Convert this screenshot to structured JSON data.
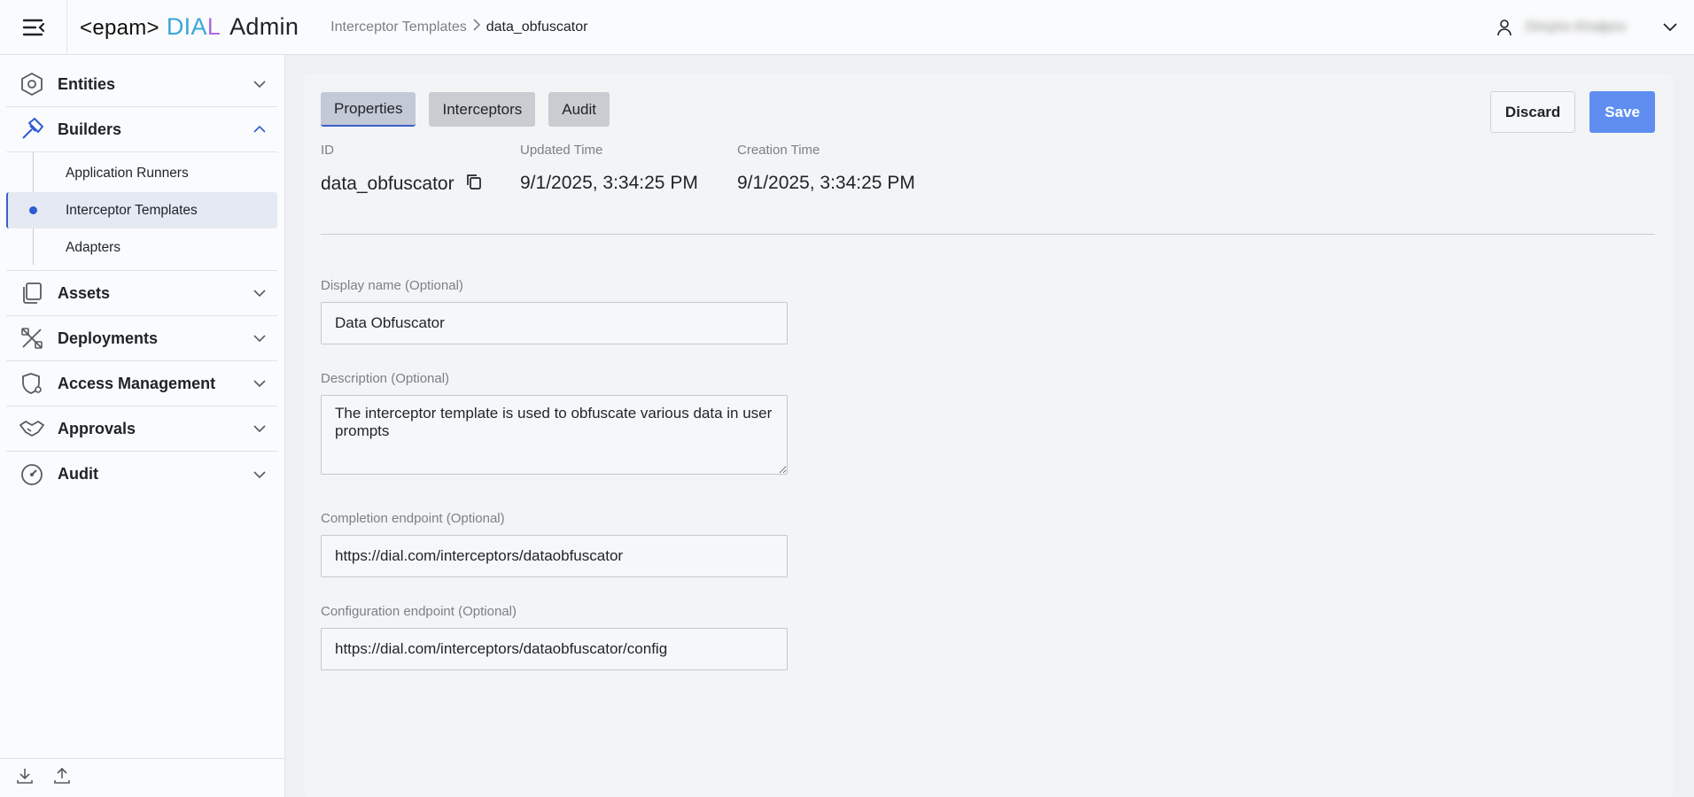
{
  "header": {
    "logo_epam": "<epam>",
    "logo_dial_1": "DIA",
    "logo_dial_2": "L",
    "logo_admin": "Admin",
    "breadcrumb": [
      "Interceptor Templates",
      "data_obfuscator"
    ],
    "user_name": "Dmytro Khalpov"
  },
  "sidebar": {
    "groups": [
      {
        "label": "Entities",
        "icon": "hexagon-icon",
        "expanded": false
      },
      {
        "label": "Builders",
        "icon": "hammer-icon",
        "expanded": true
      },
      {
        "label": "Assets",
        "icon": "files-icon",
        "expanded": false
      },
      {
        "label": "Deployments",
        "icon": "tools-icon",
        "expanded": false
      },
      {
        "label": "Access Management",
        "icon": "shield-gear-icon",
        "expanded": false
      },
      {
        "label": "Approvals",
        "icon": "handshake-icon",
        "expanded": false
      },
      {
        "label": "Audit",
        "icon": "gauge-icon",
        "expanded": false
      }
    ],
    "builders_items": [
      "Application Runners",
      "Interceptor Templates",
      "Adapters"
    ],
    "active_item": "Interceptor Templates"
  },
  "tabs": [
    "Properties",
    "Interceptors",
    "Audit"
  ],
  "active_tab": "Properties",
  "actions": {
    "discard": "Discard",
    "save": "Save"
  },
  "meta": {
    "id_label": "ID",
    "id_value": "data_obfuscator",
    "updated_label": "Updated Time",
    "updated_value": "9/1/2025, 3:34:25 PM",
    "created_label": "Creation Time",
    "created_value": "9/1/2025, 3:34:25 PM"
  },
  "form": {
    "display_name_label": "Display name (Optional)",
    "display_name_value": "Data Obfuscator",
    "description_label": "Description (Optional)",
    "description_value": "The interceptor template is used to obfuscate various data in user prompts",
    "completion_label": "Completion endpoint (Optional)",
    "completion_value": "https://dial.com/interceptors/dataobfuscator",
    "configuration_label": "Configuration endpoint (Optional)",
    "configuration_value": "https://dial.com/interceptors/dataobfuscator/config"
  },
  "colors": {
    "accent": "#3b5fc9",
    "save": "#5f8ef0",
    "dial_blue": "#3aa6d9",
    "dial_purple": "#a76ce0"
  }
}
